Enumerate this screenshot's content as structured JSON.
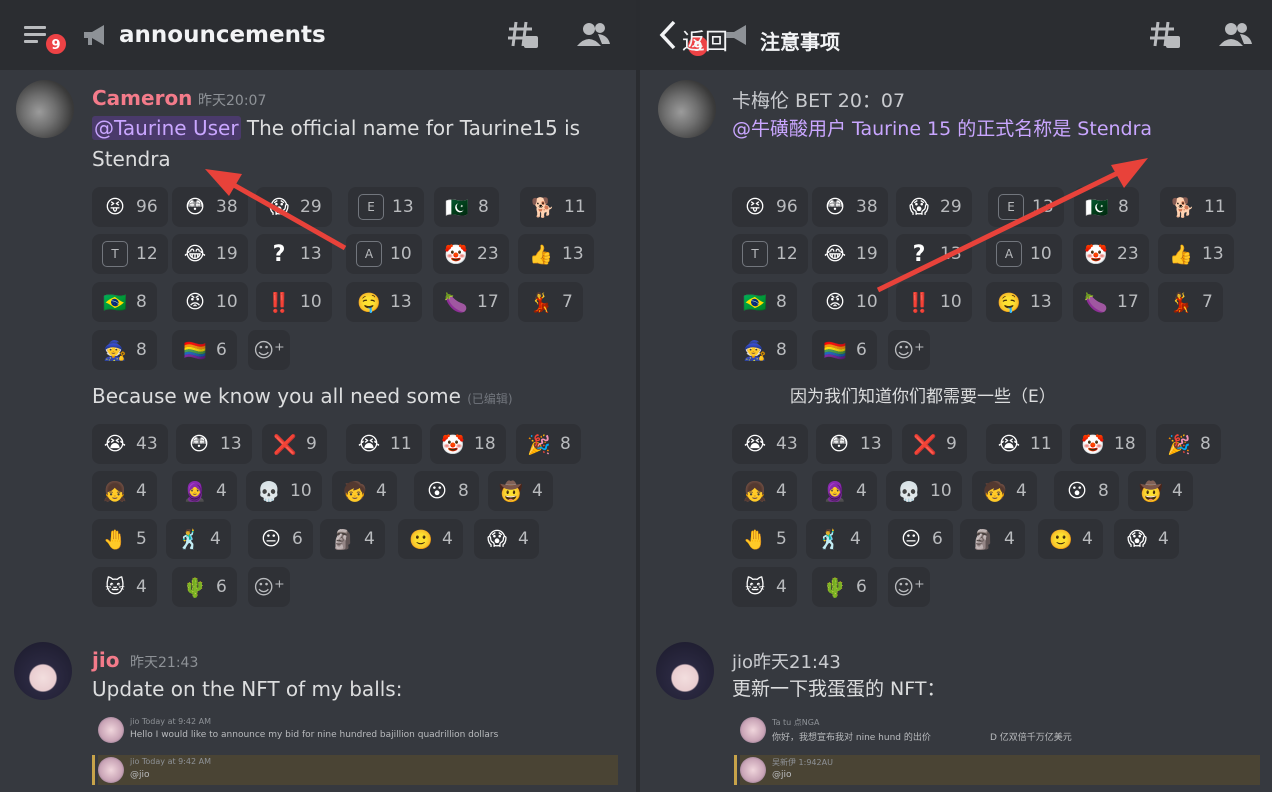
{
  "left": {
    "header": {
      "title": "announcements",
      "badge": "9"
    },
    "msg1": {
      "author": "Cameron",
      "time": "昨天20:07",
      "mention": "@Taurine User",
      "text": " The official name for Taurine15 is Stendra"
    },
    "msg2": {
      "text": "Because we know you all need some",
      "edited": "(已编辑)"
    },
    "msg3": {
      "author": "jio",
      "time": "昨天21:43",
      "text": "Update on the NFT of my balls:",
      "embed1_meta": "jio  Today at 9:42 AM",
      "embed1_text": "Hello I would like to announce my bid for nine hundred bajillion quadrillion dollars",
      "embed2_meta": "jio  Today at 9:42 AM",
      "embed2_text": "@jio"
    }
  },
  "right": {
    "header": {
      "back": "返回",
      "title": "注意事项",
      "badge": "9"
    },
    "msg1": {
      "author": "卡梅伦 BET 20：07",
      "text": "@牛磺酸用户 Taurine 15 的正式名称是 Stendra"
    },
    "msg2": {
      "text": "因为我们知道你们都需要一些（E）"
    },
    "msg3": {
      "author": "jio昨天21:43",
      "text": "更新一下我蛋蛋的 NFT：",
      "embed1_meta": "Ta tu 点NGA",
      "embed1_text": "你好，我想宣布我对 nine hund 的出价",
      "embed1_extra": "D 亿双倍千万亿美元",
      "embed2_meta": "吴新伊 1:942AU",
      "embed2_text": "@jio"
    }
  },
  "reactions1": [
    {
      "icon": "😝",
      "count": "96"
    },
    {
      "icon": "😳",
      "count": "38"
    },
    {
      "icon": "😱",
      "count": "29"
    },
    {
      "icon": "E",
      "count": "13"
    },
    {
      "icon": "🇵🇰",
      "count": "8"
    },
    {
      "icon": "🐕",
      "count": "11"
    },
    {
      "icon": "T",
      "count": "12"
    },
    {
      "icon": "😂",
      "count": "19"
    },
    {
      "icon": "?",
      "count": "13"
    },
    {
      "icon": "A",
      "count": "10"
    },
    {
      "icon": "🤡",
      "count": "23"
    },
    {
      "icon": "👍",
      "count": "13"
    },
    {
      "icon": "🇧🇷",
      "count": "8"
    },
    {
      "icon": "😡",
      "count": "10"
    },
    {
      "icon": "‼️",
      "count": "10"
    },
    {
      "icon": "🤤",
      "count": "13"
    },
    {
      "icon": "🍆",
      "count": "17"
    },
    {
      "icon": "💃",
      "count": "7"
    },
    {
      "icon": "🧙",
      "count": "8"
    },
    {
      "icon": "🏳️‍🌈",
      "count": "6"
    }
  ],
  "reactions2": [
    {
      "icon": "😭",
      "count": "43"
    },
    {
      "icon": "😳",
      "count": "13"
    },
    {
      "icon": "❌",
      "count": "9"
    },
    {
      "icon": "😭",
      "count": "11"
    },
    {
      "icon": "🤡",
      "count": "18"
    },
    {
      "icon": "🎉",
      "count": "8"
    },
    {
      "icon": "👧",
      "count": "4"
    },
    {
      "icon": "🧕",
      "count": "4"
    },
    {
      "icon": "💀",
      "count": "10"
    },
    {
      "icon": "🧒",
      "count": "4"
    },
    {
      "icon": "😮",
      "count": "8"
    },
    {
      "icon": "🤠",
      "count": "4"
    },
    {
      "icon": "🤚",
      "count": "5"
    },
    {
      "icon": "🕺",
      "count": "4"
    },
    {
      "icon": "😐",
      "count": "6"
    },
    {
      "icon": "🗿",
      "count": "4"
    },
    {
      "icon": "🙂",
      "count": "4"
    },
    {
      "icon": "😱",
      "count": "4"
    },
    {
      "icon": "🐱",
      "count": "4"
    },
    {
      "icon": "🌵",
      "count": "6"
    }
  ],
  "colors": {
    "arrow": "#e8423a",
    "name": "#f47b8a",
    "mention": "#c9a6ff"
  }
}
